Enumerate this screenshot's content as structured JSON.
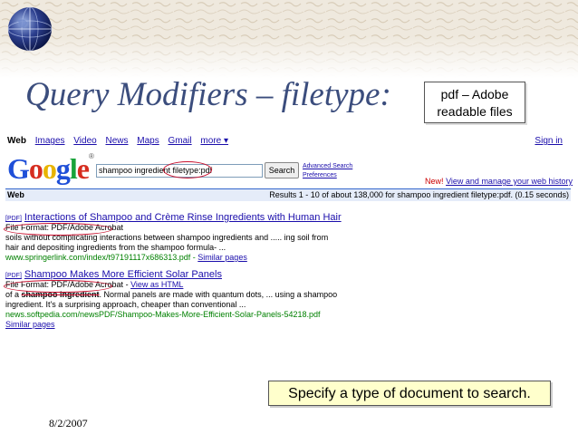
{
  "slide": {
    "title": "Query Modifiers – filetype:",
    "callout_top_line1": "pdf – Adobe",
    "callout_top_line2": "readable files",
    "callout_bottom": "Specify a type of document to search.",
    "date": "8/2/2007",
    "icon": "globe-icon"
  },
  "google": {
    "nav_items": [
      "Web",
      "Images",
      "Video",
      "News",
      "Maps",
      "Gmail",
      "more ▾"
    ],
    "sign_in": "Sign in",
    "logo": "Google",
    "query": "shampoo ingredient filetype:pdf",
    "search_button": "Search",
    "advanced_search": "Advanced Search",
    "preferences": "Preferences",
    "new_label": "New!",
    "history_link": "View and manage your web history",
    "results_label": "Web",
    "results_stats": "Results 1 - 10 of about 138,000 for shampoo ingredient filetype:pdf. (0.15 seconds)"
  },
  "results": [
    {
      "tag": "[PDF]",
      "title": "Interactions of Shampoo and Crème Rinse Ingredients with Human Hair",
      "file_format": "File Format: PDF/Adobe Acrobat",
      "snippet1": "soils without complicating interactions between shampoo ingredients and ..... ing soil from",
      "snippet2": "hair and depositing ingredients from the shampoo formula- ...",
      "url": "www.springerlink.com/index/t97191117x686313.pdf",
      "similar": "Similar pages"
    },
    {
      "tag": "[PDF]",
      "title": "Shampoo Makes More Efficient Solar Panels",
      "file_format": "File Format: PDF/Adobe Acrobat",
      "view_html": "View as HTML",
      "snippet1_prefix": "of a",
      "snippet1_strike": "shampoo ingredient",
      "snippet1_rest": ". Normal panels are made with quantum dots, ... using a shampoo",
      "snippet2": "ingredient. It's a surprising approach, cheaper than conventional ...",
      "url": "news.softpedia.com/newsPDF/Shampoo-Makes-More-Efficient-Solar-Panels-54218.pdf",
      "similar": "Similar pages"
    }
  ]
}
